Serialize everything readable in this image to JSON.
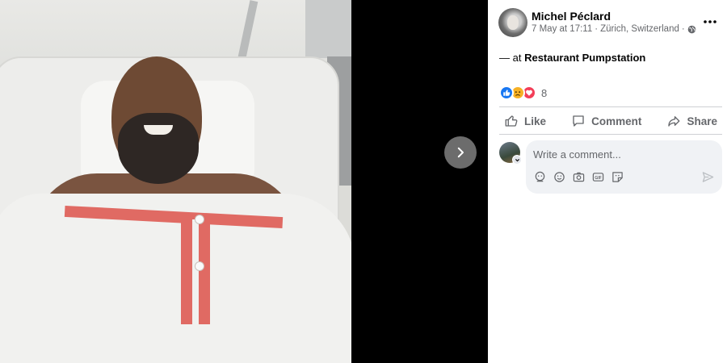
{
  "media": {
    "alt": "photo",
    "next_icon": "chevron-right-icon"
  },
  "post": {
    "author": "Michel Péclard",
    "date": "7 May at 17:11",
    "location": "Zürich, Switzerland",
    "privacy_icon": "globe-icon",
    "more_icon": "more-horizontal-icon",
    "text_prefix": "— at ",
    "place": "Restaurant Pumpstation"
  },
  "reactions": {
    "types": [
      "like",
      "sad",
      "love"
    ],
    "count": "8"
  },
  "actions": {
    "like": "Like",
    "comment": "Comment",
    "share": "Share"
  },
  "comment": {
    "placeholder": "Write a comment...",
    "tools": [
      "avatar-sticker-icon",
      "emoji-icon",
      "camera-icon",
      "gif-icon",
      "sticker-icon"
    ],
    "send_icon": "send-icon"
  },
  "colors": {
    "viewer_bg": "#000000",
    "accent": "#1877f2",
    "muted_text": "#65676b",
    "comment_bg": "#f0f2f5"
  }
}
